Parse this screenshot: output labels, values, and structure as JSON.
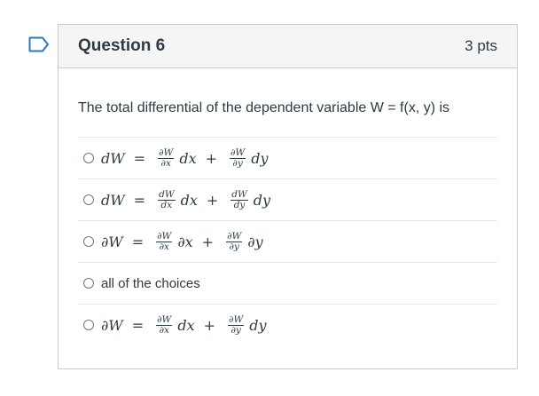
{
  "question": {
    "title": "Question 6",
    "points": "3 pts",
    "prompt": "The total differential of the dependent variable W = f(x, y) is"
  },
  "answers": [
    {
      "lhs": "dW",
      "eq": "=",
      "f1_num": "∂W",
      "f1_den": "∂x",
      "t1": "dx",
      "plus": "+",
      "f2_num": "∂W",
      "f2_den": "∂y",
      "t2": "dy"
    },
    {
      "lhs": "dW",
      "eq": "=",
      "f1_num": "dW",
      "f1_den": "dx",
      "t1": "dx",
      "plus": "+",
      "f2_num": "dW",
      "f2_den": "dy",
      "t2": "dy"
    },
    {
      "lhs": "∂W",
      "eq": "=",
      "f1_num": "∂W",
      "f1_den": "∂x",
      "t1": "∂x",
      "plus": "+",
      "f2_num": "∂W",
      "f2_den": "∂y",
      "t2": "∂y"
    },
    {
      "text": "all of the choices"
    },
    {
      "lhs": "∂W",
      "eq": "=",
      "f1_num": "∂W",
      "f1_den": "∂x",
      "t1": "dx",
      "plus": "+",
      "f2_num": "∂W",
      "f2_den": "∂y",
      "t2": "dy"
    }
  ]
}
